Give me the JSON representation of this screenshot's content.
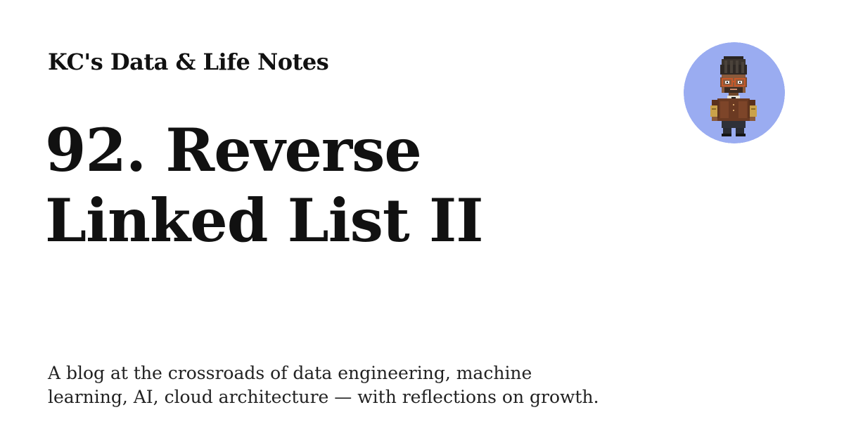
{
  "site": {
    "name": "KC's Data & Life Notes"
  },
  "post": {
    "title_lines": [
      "92. Reverse",
      "Linked List II"
    ]
  },
  "tagline": {
    "lines": [
      "A blog at the crossroads of data engineering, machine",
      "learning, AI, cloud architecture — with reflections on growth."
    ]
  },
  "avatar": {
    "icon": "pixel-art-person-avatar-icon",
    "background_color": "#9aacf1"
  }
}
